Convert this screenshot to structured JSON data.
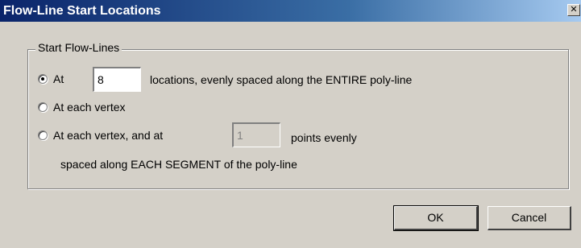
{
  "window": {
    "title": "Flow-Line Start Locations",
    "close_icon": "close-icon",
    "close_glyph": "✕"
  },
  "group": {
    "label": "Start Flow-Lines"
  },
  "options": {
    "at": {
      "selected": true,
      "label": "At",
      "value": "8",
      "suffix": "locations, evenly spaced along the ENTIRE poly-line"
    },
    "each_vertex": {
      "selected": false,
      "label": "At each vertex"
    },
    "vertex_and_points": {
      "selected": false,
      "label": "At each vertex, and at",
      "value": "1",
      "suffix": "points evenly",
      "line2": "spaced along EACH SEGMENT of the poly-line"
    }
  },
  "buttons": {
    "ok": "OK",
    "cancel": "Cancel"
  }
}
